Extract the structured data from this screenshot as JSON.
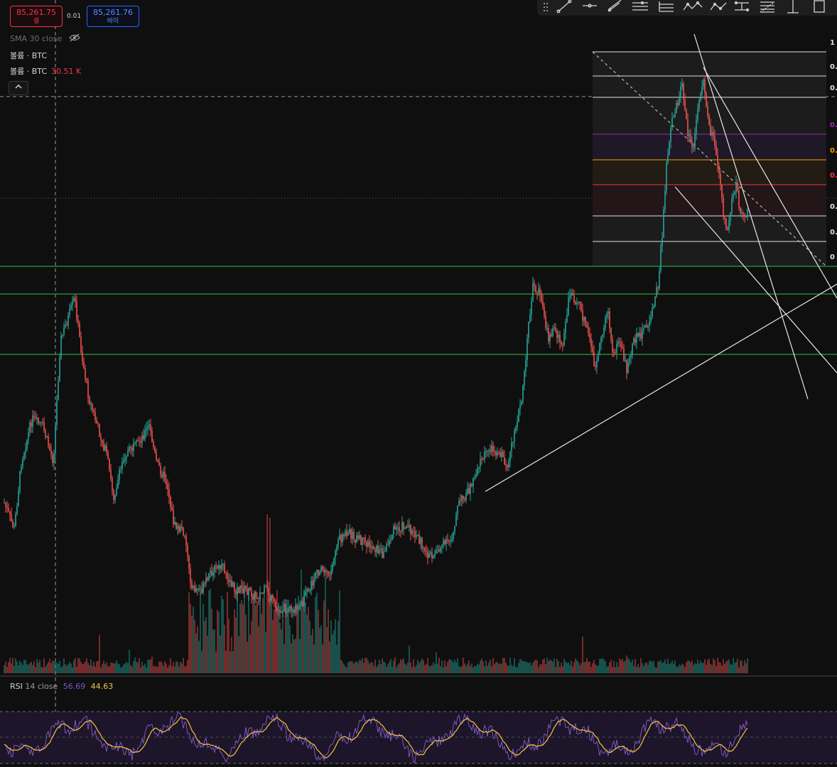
{
  "order": {
    "sell_price": "85,261.75",
    "sell_label": "셀",
    "spread": "0.01",
    "buy_price": "85,261.76",
    "buy_label": "바이"
  },
  "legends": {
    "sma": "SMA 30 close",
    "vol1_label": "볼륨 · BTC",
    "vol2_label": "볼륨 · BTC",
    "vol2_value": "30.51 K",
    "collapse_icon": "chevron-up-icon"
  },
  "toolbar_tools": [
    "trend-line-icon",
    "horizontal-line-icon",
    "parallel-channel-icon",
    "multi-line-icon",
    "pitchfork-icon",
    "polyline-icon",
    "path-icon",
    "node-line-icon",
    "fib-icon",
    "vertical-measure-icon",
    "rectangle-icon"
  ],
  "fib_levels": [
    "1",
    "0.",
    "0.",
    "0.",
    "0.",
    "0.",
    "0.",
    "0.",
    "0"
  ],
  "rsi": {
    "label": "RSI",
    "params": "14 close",
    "value1": "56.69",
    "value2": "44.63"
  },
  "colors": {
    "up": "#26a69a",
    "down": "#ef5350",
    "support": "#2e9b3e",
    "rsi_line": "#7e57c2",
    "rsi_ma": "#f5c542",
    "fib_purple": "#9c27b0",
    "fib_orange": "#ff9800",
    "fib_red": "#f23645"
  }
}
